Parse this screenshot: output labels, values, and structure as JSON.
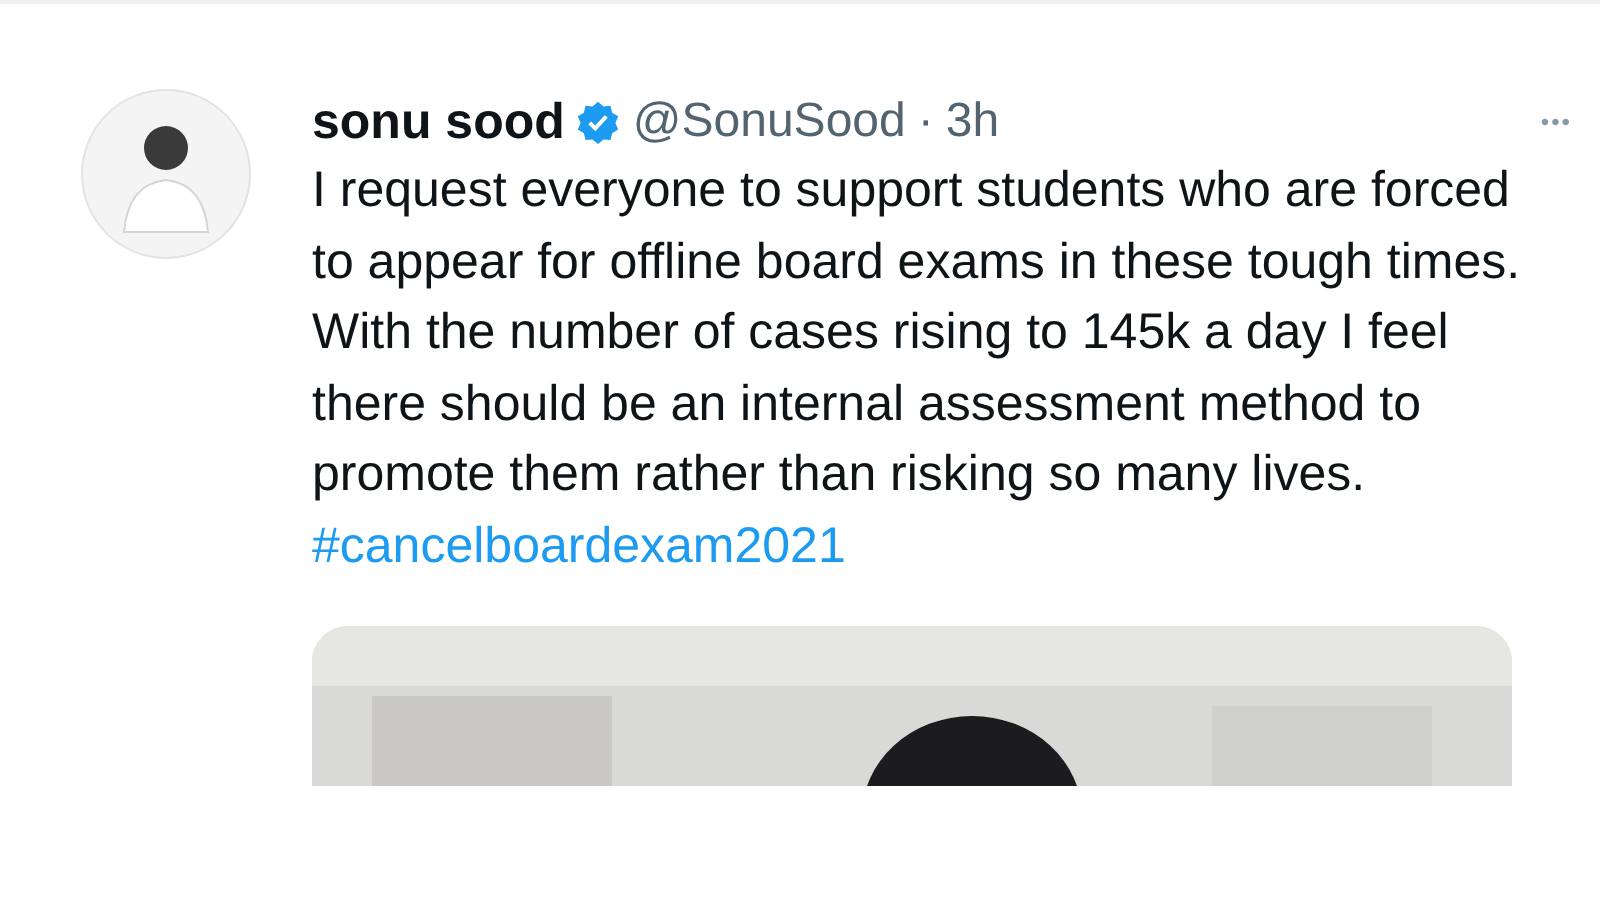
{
  "tweet": {
    "name": "sonu sood",
    "verified": true,
    "handle": "@SonuSood",
    "separator": "·",
    "time": "3h",
    "more": "•••",
    "text": "I request everyone to support students who are forced to appear for offline board exams in these tough times. With the number of cases rising to 145k a day I feel there should be an internal assessment method to promote them rather than risking so many lives.",
    "hashtag": "#cancelboardexam2021"
  }
}
